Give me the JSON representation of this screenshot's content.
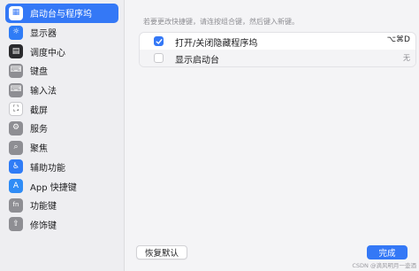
{
  "sidebar": {
    "items": [
      {
        "label": "启动台与程序坞",
        "icon": "launchpad-icon",
        "icon_color": "#3a7bf7",
        "glyph": "▦",
        "selected": true
      },
      {
        "label": "显示器",
        "icon": "display-icon",
        "icon_color": "#2f7cf6",
        "glyph": "☼",
        "selected": false
      },
      {
        "label": "调度中心",
        "icon": "mission-control-icon",
        "icon_color": "#2b2b2e",
        "glyph": "▤",
        "selected": false
      },
      {
        "label": "键盘",
        "icon": "keyboard-icon",
        "icon_color": "#8e8e93",
        "glyph": "⌨",
        "selected": false
      },
      {
        "label": "输入法",
        "icon": "input-method-icon",
        "icon_color": "#8e8e93",
        "glyph": "⌨",
        "selected": false
      },
      {
        "label": "截屏",
        "icon": "screenshot-icon",
        "icon_color": "#ffffff",
        "glyph": "⛶",
        "selected": false
      },
      {
        "label": "服务",
        "icon": "services-icon",
        "icon_color": "#8e8e93",
        "glyph": "⚙",
        "selected": false
      },
      {
        "label": "聚焦",
        "icon": "spotlight-icon",
        "icon_color": "#8e8e93",
        "glyph": "⌕",
        "selected": false
      },
      {
        "label": "辅助功能",
        "icon": "accessibility-icon",
        "icon_color": "#2f7cf6",
        "glyph": "♿",
        "selected": false
      },
      {
        "label": "App 快捷键",
        "icon": "app-store-icon",
        "icon_color": "#2f8cf6",
        "glyph": "A",
        "selected": false
      },
      {
        "label": "功能键",
        "icon": "fn-key-icon",
        "icon_color": "#8e8e93",
        "glyph": "fn",
        "selected": false
      },
      {
        "label": "修饰键",
        "icon": "modifier-key-icon",
        "icon_color": "#8e8e93",
        "glyph": "⇧",
        "selected": false
      }
    ]
  },
  "main": {
    "hint": "若要更改快捷键，请连按组合键，然后键入新键。",
    "rows": [
      {
        "label": "打开/关闭隐藏程序坞",
        "shortcut": "⌥⌘D",
        "checked": true
      },
      {
        "label": "显示启动台",
        "shortcut": "无",
        "checked": false
      }
    ],
    "restore_label": "恢复默认",
    "done_label": "完成"
  },
  "watermark": "CSDN @滴风明月一壶酒",
  "colors": {
    "accent": "#3478f6",
    "sidebar_bg": "#eeeef1",
    "main_bg": "#f4f4f6"
  }
}
